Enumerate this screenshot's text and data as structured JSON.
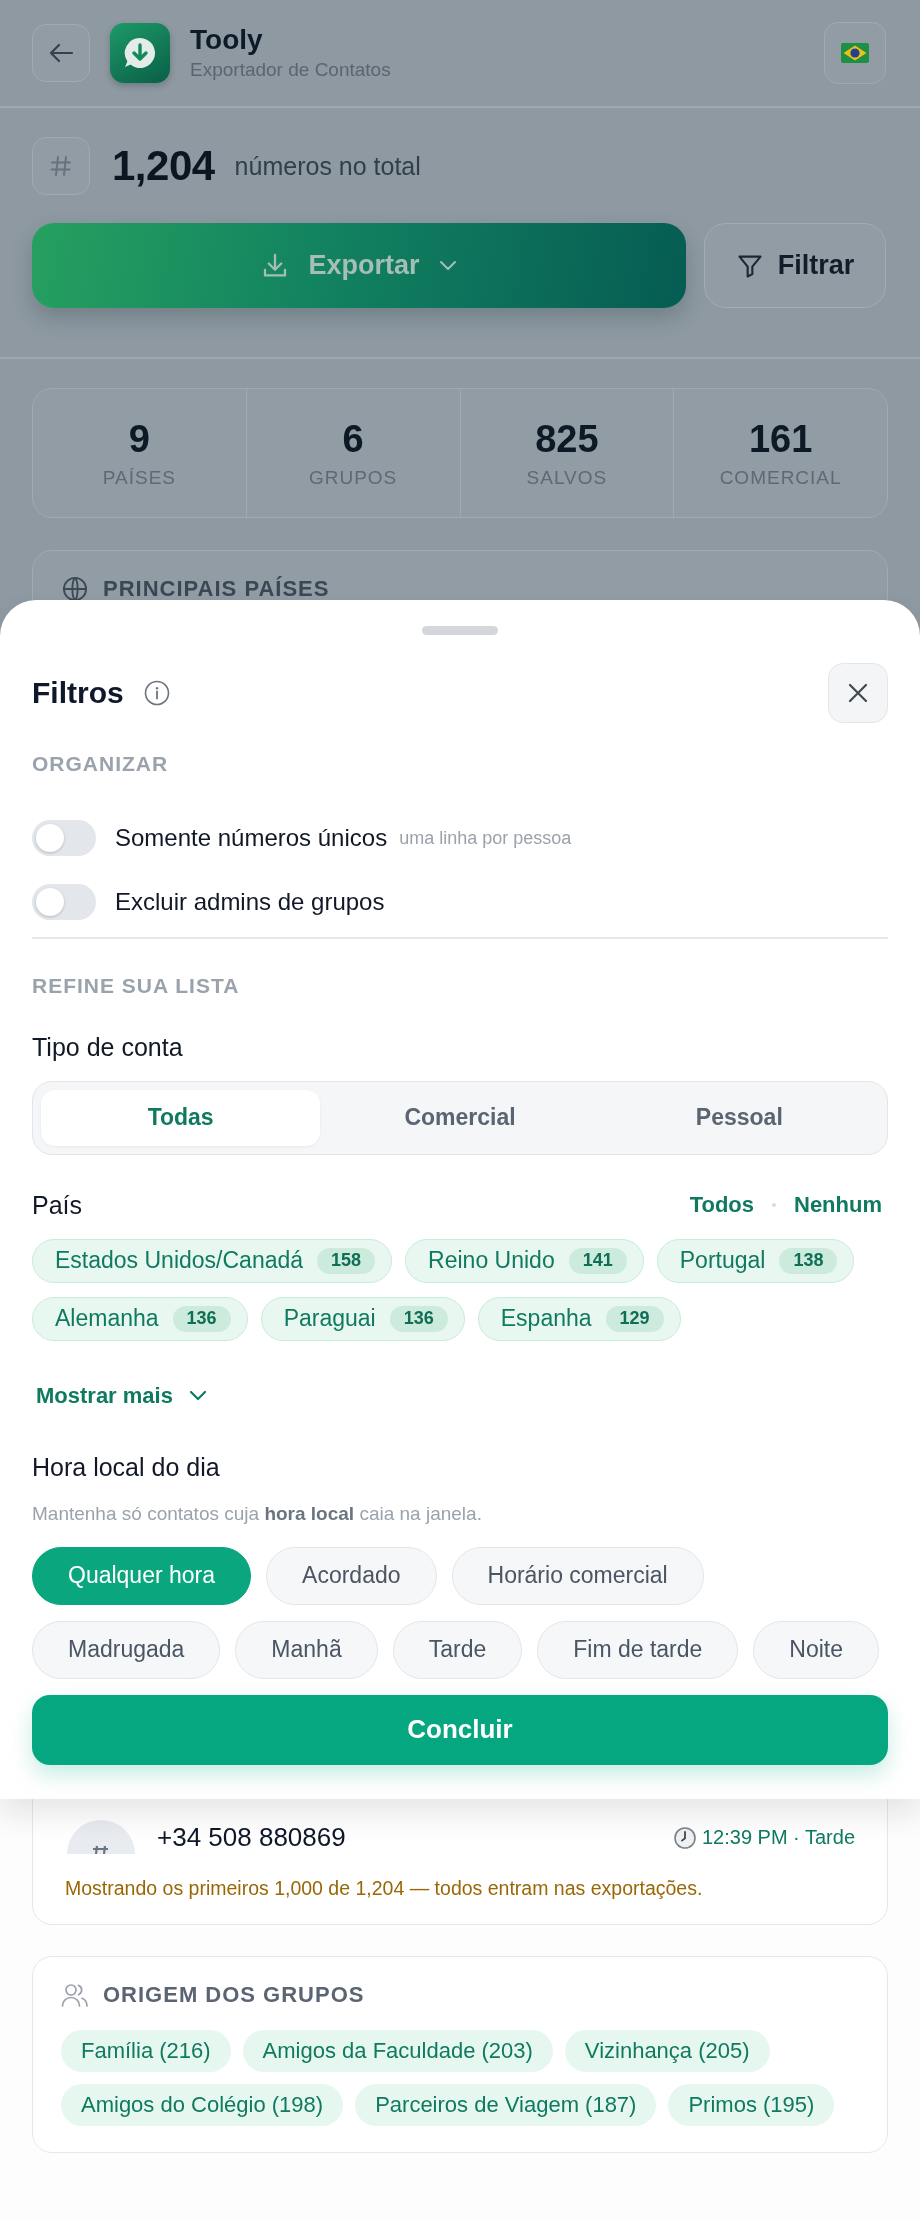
{
  "header": {
    "title": "Tooly",
    "subtitle": "Exportador de Contatos"
  },
  "summary": {
    "total": "1,204",
    "total_label": "números no total"
  },
  "actions": {
    "export": "Exportar",
    "filter": "Filtrar"
  },
  "stats": [
    {
      "value": "9",
      "label": "PAÍSES"
    },
    {
      "value": "6",
      "label": "GRUPOS"
    },
    {
      "value": "825",
      "label": "SALVOS"
    },
    {
      "value": "161",
      "label": "COMERCIAL"
    }
  ],
  "top_countries": {
    "title": "PRINCIPAIS PAÍSES"
  },
  "filters": {
    "title": "Filtros",
    "organize": {
      "heading": "ORGANIZAR",
      "toggles": [
        {
          "label": "Somente números únicos",
          "hint": "uma linha por pessoa",
          "on": false
        },
        {
          "label": "Excluir admins de grupos",
          "on": false
        }
      ]
    },
    "refine": {
      "heading": "REFINE SUA LISTA",
      "account_type": {
        "label": "Tipo de conta",
        "options": [
          {
            "label": "Todas",
            "selected": true
          },
          {
            "label": "Comercial",
            "selected": false
          },
          {
            "label": "Pessoal",
            "selected": false
          }
        ]
      },
      "country": {
        "label": "País",
        "links": [
          "Todos",
          "Nenhum"
        ],
        "chips": [
          {
            "name": "Estados Unidos/Canadá",
            "count": "158",
            "selected": true
          },
          {
            "name": "Reino Unido",
            "count": "141",
            "selected": true
          },
          {
            "name": "Portugal",
            "count": "138",
            "selected": true
          },
          {
            "name": "Alemanha",
            "count": "136",
            "selected": true
          },
          {
            "name": "Paraguai",
            "count": "136",
            "selected": true
          },
          {
            "name": "Espanha",
            "count": "129",
            "selected": true
          }
        ],
        "show_more": "Mostrar mais"
      },
      "local_time": {
        "label": "Hora local do dia",
        "description": "Mantenha só contatos cuja **hora local** caia na janela.",
        "options": [
          {
            "label": "Qualquer hora",
            "selected": true
          },
          {
            "label": "Acordado",
            "selected": false
          },
          {
            "label": "Horário comercial",
            "selected": false
          },
          {
            "label": "Madrugada",
            "selected": false
          },
          {
            "label": "Manhã",
            "selected": false
          },
          {
            "label": "Tarde",
            "selected": false
          },
          {
            "label": "Fim de tarde",
            "selected": false
          },
          {
            "label": "Noite",
            "selected": false
          }
        ]
      }
    },
    "done": "Concluir"
  },
  "contact_preview": {
    "phone": "+34 508 880869",
    "time": "12:39 PM · Tarde",
    "note": "Mostrando os primeiros 1,000 de 1,204 — todos entram nas exportações."
  },
  "group_origins": {
    "title": "ORIGEM DOS GRUPOS",
    "groups": [
      "Família (216)",
      "Amigos da Faculdade (203)",
      "Vizinhança (205)",
      "Amigos do Colégio (198)",
      "Parceiros de Viagem (187)",
      "Primos (195)"
    ]
  }
}
